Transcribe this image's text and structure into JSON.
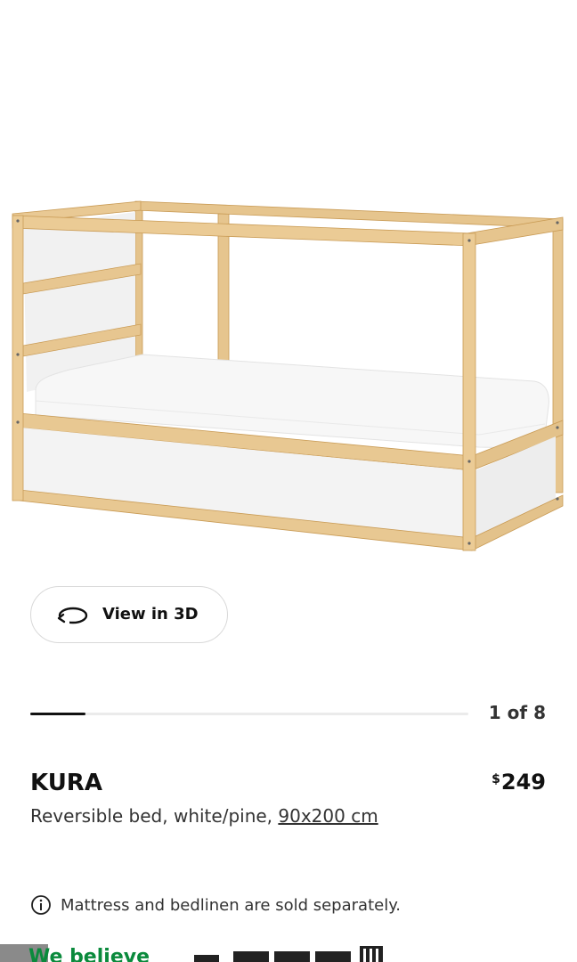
{
  "product": {
    "name": "KURA",
    "currency": "$",
    "price": "249",
    "description": "Reversible bed, white/pine, ",
    "size": "90x200 cm",
    "note": "Mattress and bedlinen are sold separately."
  },
  "gallery": {
    "view3d_label": "View in 3D",
    "current": 1,
    "total": 8,
    "counter": "1 of 8"
  },
  "footer": {
    "banner_text": "We believe"
  },
  "colors": {
    "wood": "#e2c18a",
    "panel": "#f2f2f2",
    "text": "#111111",
    "green": "#0a8a3c"
  }
}
